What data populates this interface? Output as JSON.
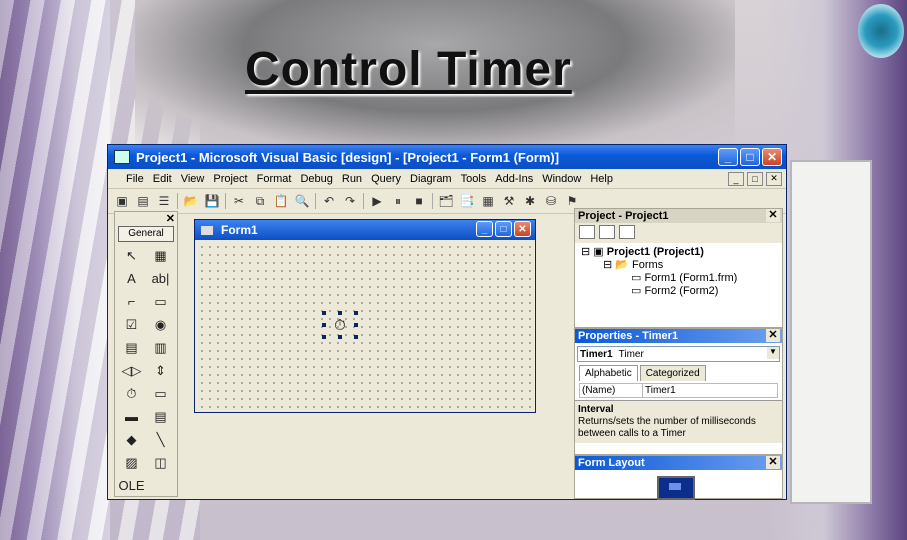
{
  "slide": {
    "title": "Control Timer"
  },
  "ide": {
    "title": "Project1 - Microsoft Visual Basic [design] - [Project1 - Form1 (Form)]",
    "window_buttons": [
      "_",
      "□",
      "✕"
    ],
    "menu": [
      "File",
      "Edit",
      "View",
      "Project",
      "Format",
      "Debug",
      "Run",
      "Query",
      "Diagram",
      "Tools",
      "Add-Ins",
      "Window",
      "Help"
    ],
    "mdi_buttons": [
      "_",
      "□",
      "✕"
    ],
    "toolbar_icons": [
      "add-project-icon",
      "add-form-icon",
      "menu-editor-icon",
      "open-icon",
      "save-icon",
      "cut-icon",
      "copy-icon",
      "paste-icon",
      "find-icon",
      "undo-icon",
      "redo-icon",
      "run-icon",
      "pause-icon",
      "stop-icon",
      "project-explorer-icon",
      "properties-icon",
      "form-layout-icon",
      "object-browser-icon",
      "toolbox-icon",
      "data-view-icon"
    ]
  },
  "toolbox": {
    "close": "✕",
    "header": "General",
    "tools": [
      {
        "name": "pointer",
        "glyph": "↖"
      },
      {
        "name": "picturebox",
        "glyph": "▦"
      },
      {
        "name": "label",
        "glyph": "A"
      },
      {
        "name": "textbox",
        "glyph": "ab|"
      },
      {
        "name": "frame",
        "glyph": "⌐"
      },
      {
        "name": "commandbutton",
        "glyph": "▭"
      },
      {
        "name": "checkbox",
        "glyph": "☑"
      },
      {
        "name": "optionbutton",
        "glyph": "◉"
      },
      {
        "name": "combobox",
        "glyph": "▤"
      },
      {
        "name": "listbox",
        "glyph": "▥"
      },
      {
        "name": "hscrollbar",
        "glyph": "◁▷"
      },
      {
        "name": "vscrollbar",
        "glyph": "⇕"
      },
      {
        "name": "timer",
        "glyph": "⏱"
      },
      {
        "name": "drivelistbox",
        "glyph": "▭"
      },
      {
        "name": "dirlistbox",
        "glyph": "▬"
      },
      {
        "name": "filelistbox",
        "glyph": "▤"
      },
      {
        "name": "shape",
        "glyph": "◆"
      },
      {
        "name": "line",
        "glyph": "╲"
      },
      {
        "name": "image",
        "glyph": "▨"
      },
      {
        "name": "data",
        "glyph": "◫"
      },
      {
        "name": "ole",
        "glyph": "OLE"
      }
    ]
  },
  "form1": {
    "title": "Form1",
    "buttons": [
      "_",
      "□",
      "✕"
    ],
    "timer_glyph": "⏱"
  },
  "project": {
    "title": "Project - Project1",
    "close": "✕",
    "tree": [
      "Project1 (Project1)",
      "Forms",
      "Form1 (Form1.frm)",
      "Form2 (Form2)"
    ]
  },
  "properties": {
    "title": "Properties - Timer1",
    "close": "✕",
    "object_name": "Timer1",
    "object_type": "Timer",
    "tabs": [
      "Alphabetic",
      "Categorized"
    ],
    "rows": [
      {
        "key": "(Name)",
        "value": "Timer1"
      }
    ],
    "desc_title": "Interval",
    "desc_text": "Returns/sets the number of milliseconds between calls to a Timer"
  },
  "form_layout": {
    "title": "Form Layout",
    "close": "✕"
  },
  "colors": {
    "title_blue": "#0b4fc4",
    "face": "#ece9d8",
    "close_red": "#c8452a"
  }
}
